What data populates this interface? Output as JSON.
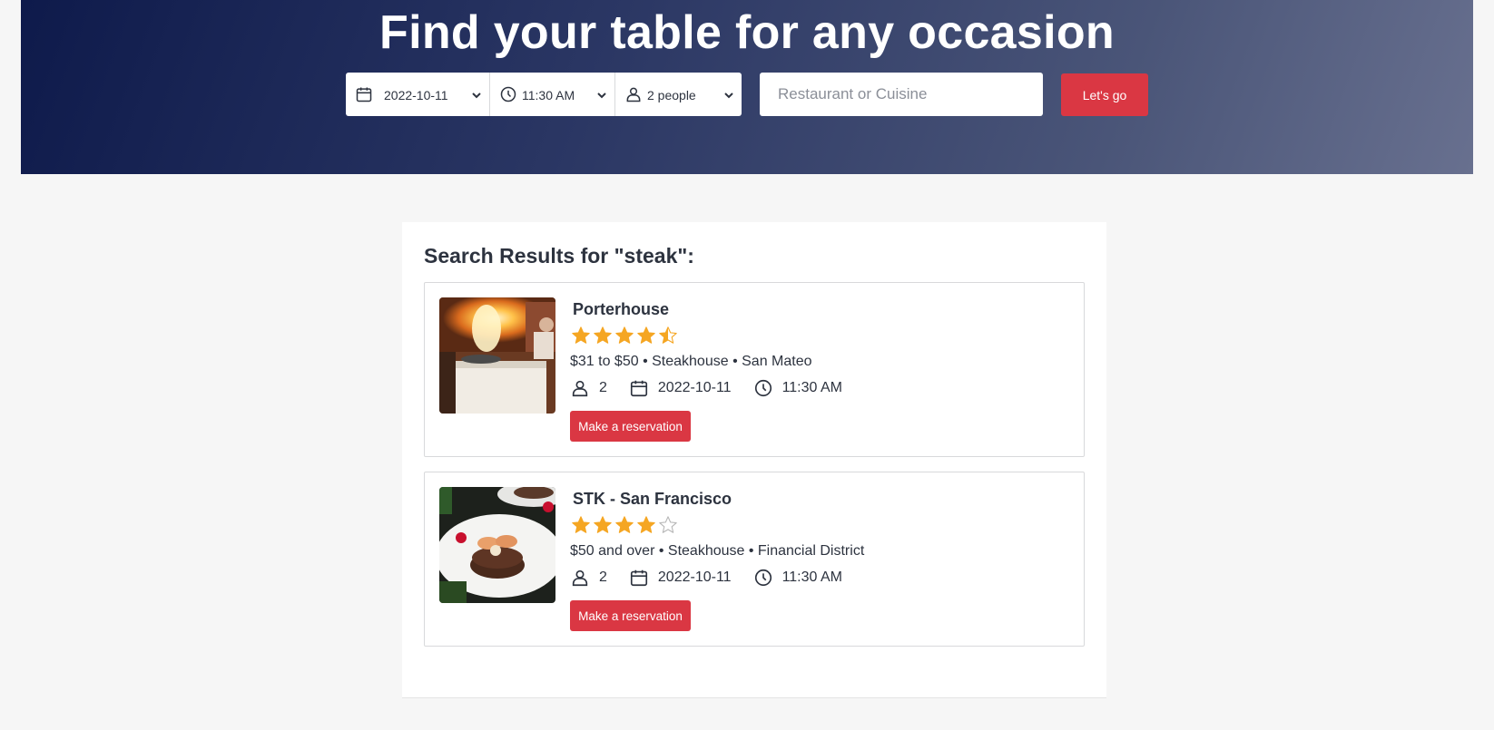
{
  "hero": {
    "title": "Find your table for any occasion",
    "date": "2022-10-11",
    "time": "11:30 AM",
    "party": "2 people",
    "search_placeholder": "Restaurant or Cuisine",
    "go_label": "Let's go"
  },
  "results": {
    "heading": "Search Results for \"steak\":",
    "items": [
      {
        "name": "Porterhouse",
        "rating": 4.5,
        "meta": "$31 to $50 • Steakhouse • San Mateo",
        "party": "2",
        "date": "2022-10-11",
        "time": "11:30 AM",
        "reserve_label": "Make a reservation",
        "image": "flambe-tableside-photo"
      },
      {
        "name": "STK - San Francisco",
        "rating": 4,
        "meta": "$50 and over • Steakhouse • Financial District",
        "party": "2",
        "date": "2022-10-11",
        "time": "11:30 AM",
        "reserve_label": "Make a reservation",
        "image": "steak-with-shrimp-photo"
      }
    ]
  },
  "colors": {
    "accent": "#da3743",
    "star": "#f5a623",
    "star_empty": "#b7b7b7",
    "text": "#2d333f"
  }
}
